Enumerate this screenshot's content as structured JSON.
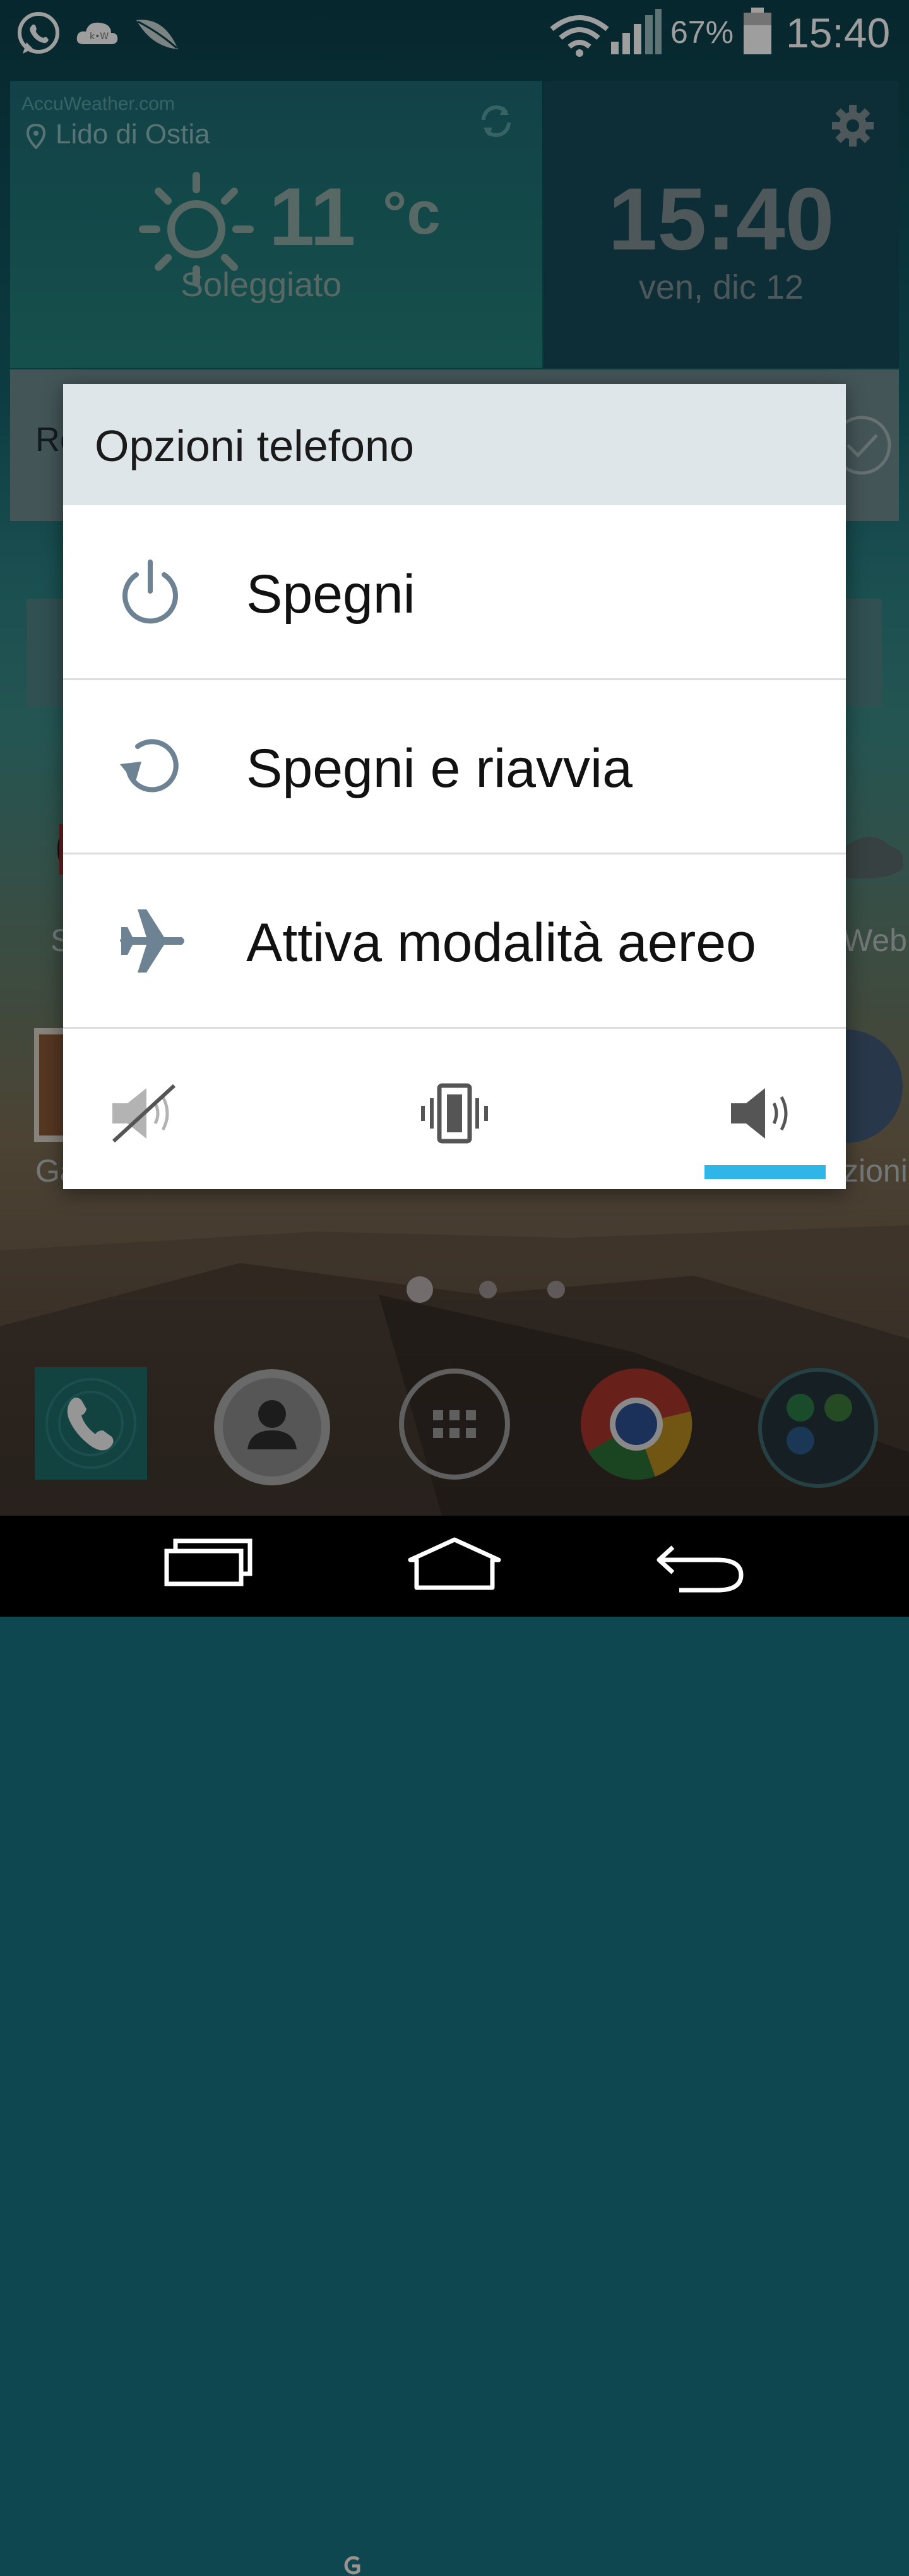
{
  "status_bar": {
    "battery_percent": "67%",
    "clock": "15:40",
    "icons": [
      "whatsapp-icon",
      "weather-cloud-icon",
      "leaf-icon",
      "wifi-icon",
      "signal-icon",
      "battery-icon"
    ]
  },
  "widget": {
    "provider": "AccuWeather.com",
    "location": "Lido di Ostia",
    "temperature": "11",
    "temperature_unit": "°c",
    "condition": "Soleggiato",
    "time": "15:40",
    "date": "ven, dic 12"
  },
  "background": {
    "widget_strip_text": "Re",
    "app_label_left": "S",
    "app_label_right": "Web",
    "app_label_left2": "Ga",
    "app_label_right2": "zioni"
  },
  "dialog": {
    "title": "Opzioni telefono",
    "items": [
      {
        "label": "Spegni",
        "icon": "power-icon"
      },
      {
        "label": "Spegni e riavvia",
        "icon": "restart-icon"
      },
      {
        "label": "Attiva modalità aereo",
        "icon": "airplane-icon"
      }
    ],
    "sound_modes": [
      {
        "name": "mute",
        "icon": "mute-icon",
        "selected": false
      },
      {
        "name": "vibrate",
        "icon": "vibrate-icon",
        "selected": false
      },
      {
        "name": "sound",
        "icon": "volume-icon",
        "selected": true
      }
    ],
    "accent_color": "#2eb6e8"
  },
  "home": {
    "page_count": 3,
    "current_page": 1
  },
  "dock": [
    "phone-icon",
    "contacts-icon",
    "apps-icon",
    "chrome-icon",
    "messaging-folder-icon"
  ],
  "navbar": [
    "recents-button",
    "home-button",
    "back-button"
  ]
}
